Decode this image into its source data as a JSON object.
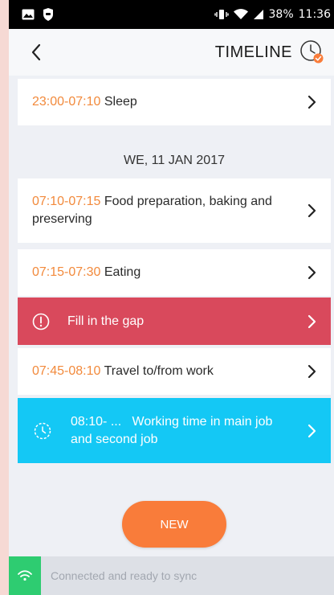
{
  "status_bar": {
    "battery": "38%",
    "time": "11:36"
  },
  "header": {
    "title": "TIMELINE"
  },
  "entries": [
    {
      "time": "23:00-07:10",
      "label": "Sleep"
    },
    {
      "time": "07:10-07:15",
      "label": "Food preparation, baking and preserving"
    },
    {
      "time": "07:15-07:30",
      "label": "Eating"
    },
    {
      "time": "07:45-08:10",
      "label": "Travel to/from work"
    }
  ],
  "date_header": "WE, 11 JAN 2017",
  "gap": {
    "label": "Fill in the gap"
  },
  "working": {
    "time": "08:10- ...",
    "label": "Working time in main job and second job"
  },
  "new_button": "NEW",
  "sync": {
    "text": "Connected and ready to sync"
  },
  "colors": {
    "accent_orange": "#f97c3a",
    "gap_red": "#d9495c",
    "working_cyan": "#14c8f5",
    "sync_green": "#2ecc71"
  }
}
